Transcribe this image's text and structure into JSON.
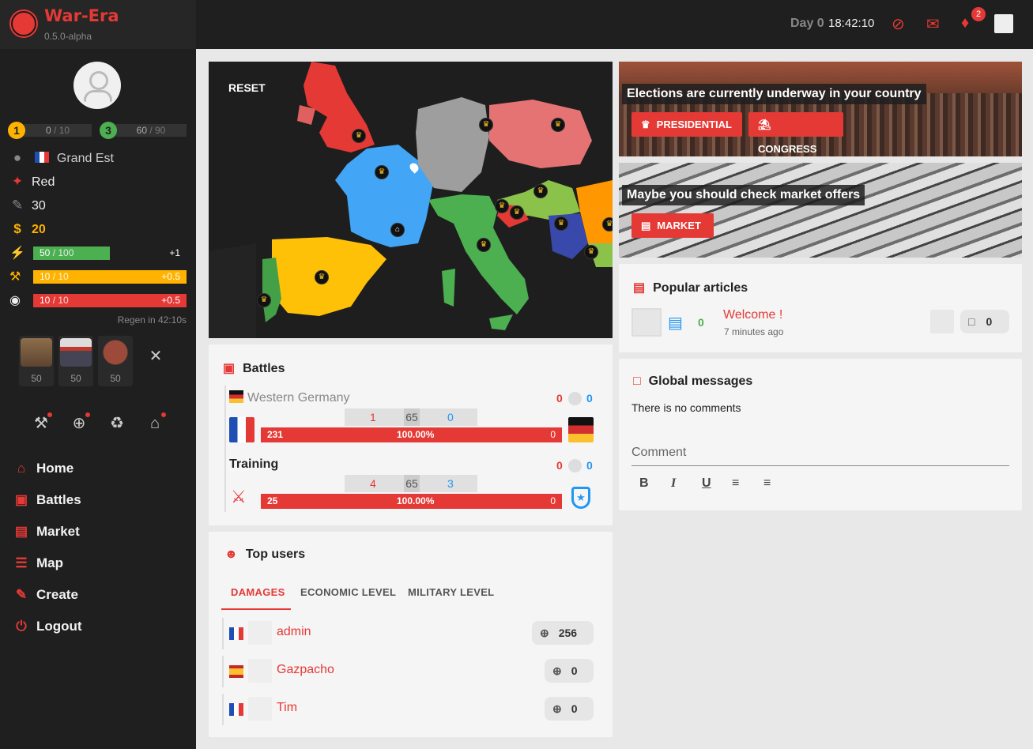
{
  "app": {
    "name": "War-Era",
    "version": "0.5.0-alpha"
  },
  "player": {
    "level1": {
      "num": "1",
      "value": "0",
      "max": "/ 10"
    },
    "level2": {
      "num": "3",
      "value": "60",
      "max": "/ 90"
    },
    "region": "Grand Est",
    "party": "Red",
    "strength": "30",
    "money": "20",
    "energy": {
      "value": "50",
      "max": "/ 100",
      "plus": "+1",
      "fraction": 0.5
    },
    "work": {
      "value": "10",
      "max": "/ 10",
      "plus": "+0.5",
      "fraction": 1.0
    },
    "health": {
      "value": "10",
      "max": "/ 10",
      "plus": "+0.5",
      "fraction": 1.0
    },
    "regen": "Regen in 42:10s",
    "food": [
      {
        "name": "bread",
        "count": "50"
      },
      {
        "name": "sushi",
        "count": "50"
      },
      {
        "name": "steak",
        "count": "50"
      }
    ]
  },
  "nav": [
    "Home",
    "Battles",
    "Market",
    "Map",
    "Create",
    "Logout"
  ],
  "topbar": {
    "day": "Day 0",
    "time": "18:42:10",
    "notifications": "2"
  },
  "map": {
    "reset": "RESET"
  },
  "battles": {
    "title": "Battles",
    "items": [
      {
        "name": "Western Germany",
        "left_score": "0",
        "right_score": "0",
        "a": "1",
        "mid": "65",
        "b": "0",
        "damage": "231",
        "percent": "100.00%",
        "right_damage": "0"
      },
      {
        "name": "Training",
        "left_score": "0",
        "right_score": "0",
        "a": "4",
        "mid": "65",
        "b": "3",
        "damage": "25",
        "percent": "100.00%",
        "right_damage": "0"
      }
    ]
  },
  "top_users": {
    "title": "Top users",
    "tabs": [
      "DAMAGES",
      "ECONOMIC LEVEL",
      "MILITARY LEVEL"
    ],
    "users": [
      {
        "name": "admin",
        "score": "256"
      },
      {
        "name": "Gazpacho",
        "score": "0"
      },
      {
        "name": "Tim",
        "score": "0"
      }
    ]
  },
  "elections": {
    "text": "Elections are currently underway in your country",
    "presidential": "PRESIDENTIAL",
    "congress": "CONGRESS"
  },
  "market_banner": {
    "text": "Maybe you should check market offers",
    "button": "MARKET"
  },
  "articles": {
    "title": "Popular articles",
    "count": "0",
    "article_title": "Welcome !",
    "time": "7 minutes ago",
    "comments": "0"
  },
  "messages": {
    "title": "Global messages",
    "empty": "There is no comments",
    "placeholder": "Comment"
  },
  "colors": {
    "accent": "#e53935",
    "blue": "#2196f3",
    "green": "#4caf50",
    "yellow": "#ffb300"
  }
}
